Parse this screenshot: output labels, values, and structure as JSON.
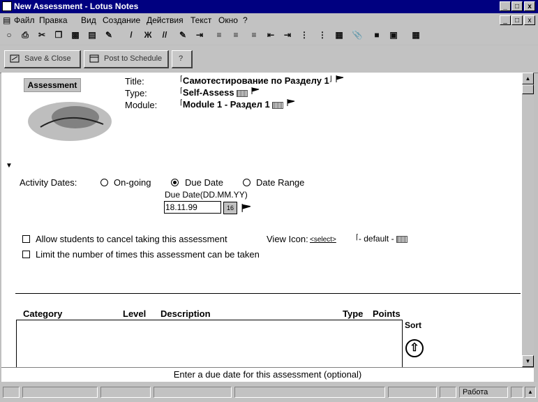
{
  "window": {
    "title": "New Assessment - Lotus Notes"
  },
  "menu": [
    "Файл",
    "Правка",
    "Вид",
    "Создание",
    "Действия",
    "Текст",
    "Окно",
    "?"
  ],
  "toolbar_icons": [
    "open-icon",
    "print-icon",
    "cut-icon",
    "copy-icon",
    "paste-icon",
    "properties-icon",
    "ink-icon",
    "italic-icon",
    "bold-icon",
    "italic2-icon",
    "highlight-icon",
    "indent-icon",
    "align-left-icon",
    "align-center-icon",
    "list-icon",
    "outdent-icon",
    "numbered-list-icon",
    "table-icon",
    "section-icon",
    "attach-icon",
    "link-icon",
    "image-icon",
    "view-icon",
    "hotspot-icon"
  ],
  "actions": {
    "save_close": "Save & Close",
    "post_schedule": "Post to Schedule",
    "help": "?"
  },
  "form": {
    "banner": "Assessment",
    "title_label": "Title:",
    "title_value": "Самотестирование по Разделу 1",
    "type_label": "Type:",
    "type_value": "Self-Assess",
    "module_label": "Module:",
    "module_value": "Module 1 - Раздел 1",
    "activity_label": "Activity Dates:",
    "opt_ongoing": "On-going",
    "opt_due": "Due Date",
    "opt_range": "Date Range",
    "due_label": "Due Date(DD.MM.YY)",
    "due_value": "18.11.99",
    "cal_icon": "16",
    "allow_cancel": "Allow students to cancel taking this assessment",
    "view_icon_label": "View Icon:",
    "view_icon_select": "<select>",
    "view_icon_value": "- default -",
    "limit_times": "Limit the number of times this assessment can be taken"
  },
  "table": {
    "headers": [
      "Category",
      "Level",
      "Description",
      "Type",
      "Points"
    ],
    "sort_label": "Sort"
  },
  "status": {
    "hint": "Enter a due date for this assessment (optional)",
    "office": "Работа"
  }
}
